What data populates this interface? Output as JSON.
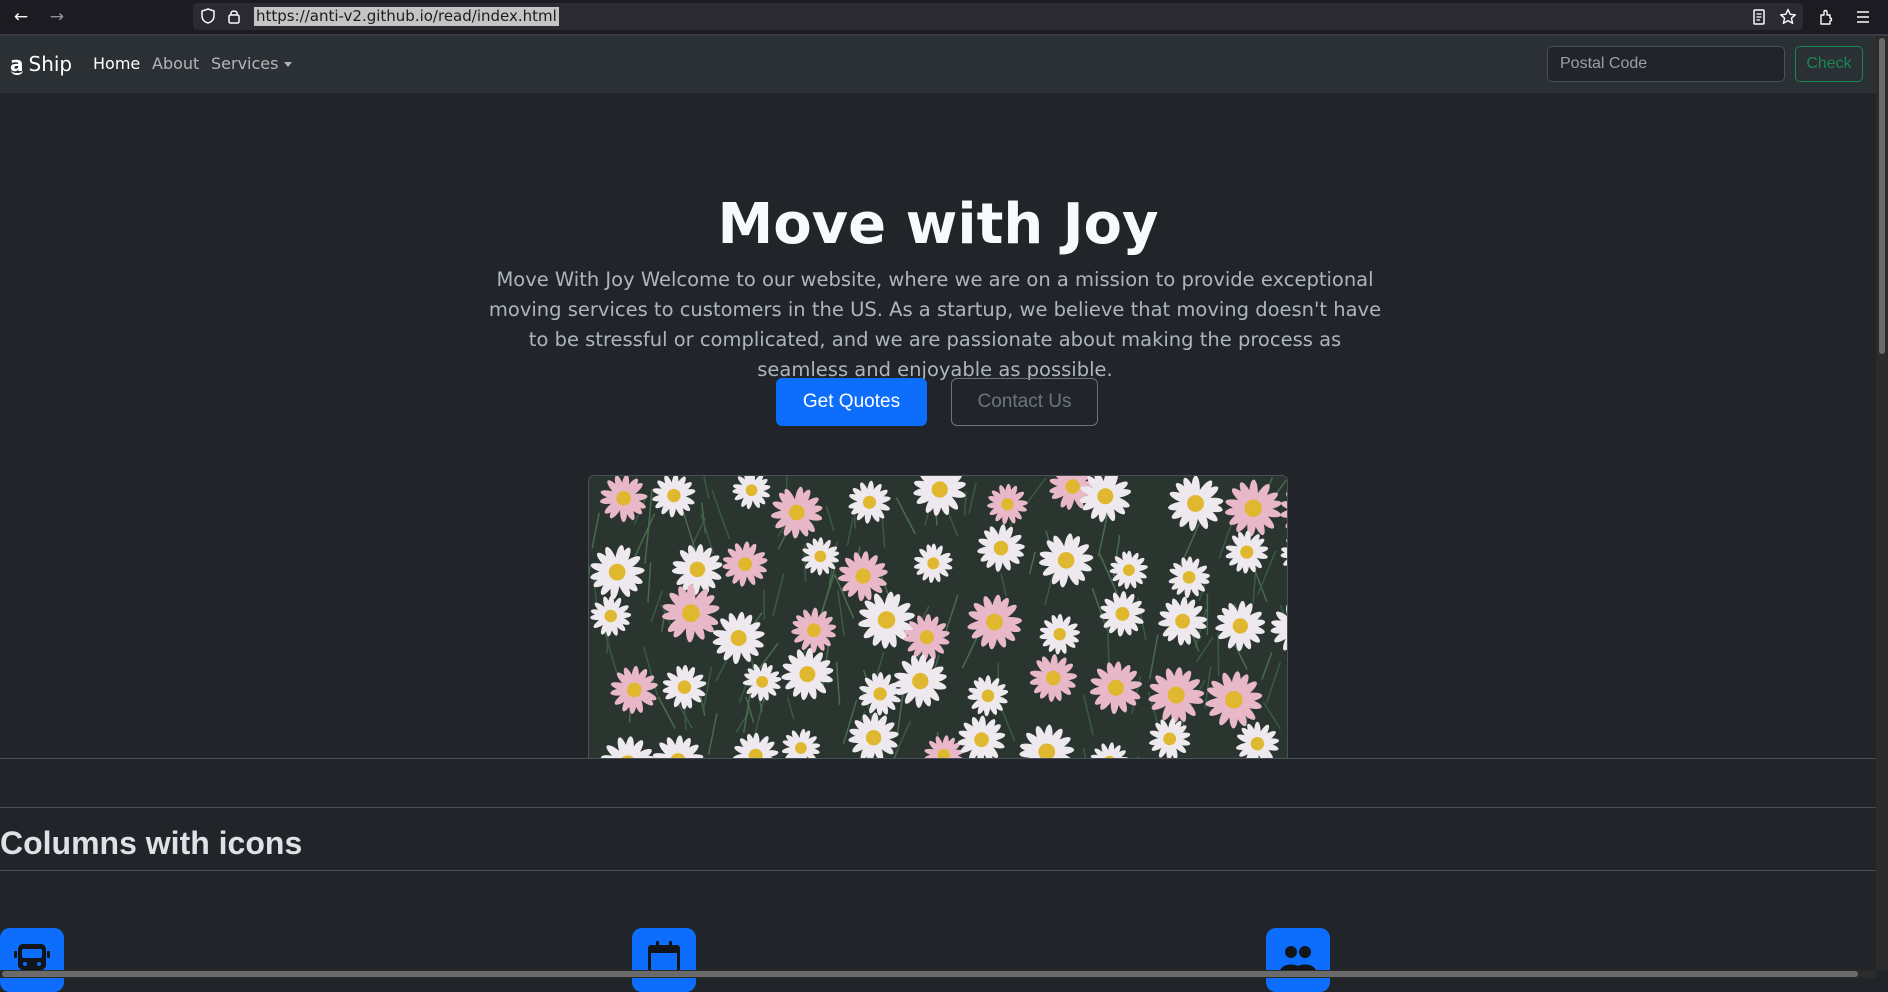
{
  "browser": {
    "url": "https://anti-v2.github.io/read/index.html"
  },
  "navbar": {
    "brand_logo": "a",
    "brand_name": "Ship",
    "links": [
      {
        "label": "Home"
      },
      {
        "label": "About"
      },
      {
        "label": "Services"
      }
    ],
    "postal_placeholder": "Postal Code",
    "check_label": "Check"
  },
  "hero": {
    "title": "Move with Joy",
    "text": "Move With Joy Welcome to our website, where we are on a mission to provide exceptional moving services to customers in the US. As a startup, we believe that moving doesn't have to be stressful or complicated, and we are passionate about making the process as seamless and enjoyable as possible.",
    "primary_button": "Get Quotes",
    "secondary_button": "Contact Us"
  },
  "features": {
    "title": "Columns with icons",
    "icons": [
      "bus-icon",
      "calendar-icon",
      "people-icon"
    ]
  },
  "colors": {
    "background": "#212529",
    "navbar": "#2b3035",
    "primary": "#0d6efd",
    "success": "#198754",
    "secondary": "#6c757d"
  }
}
